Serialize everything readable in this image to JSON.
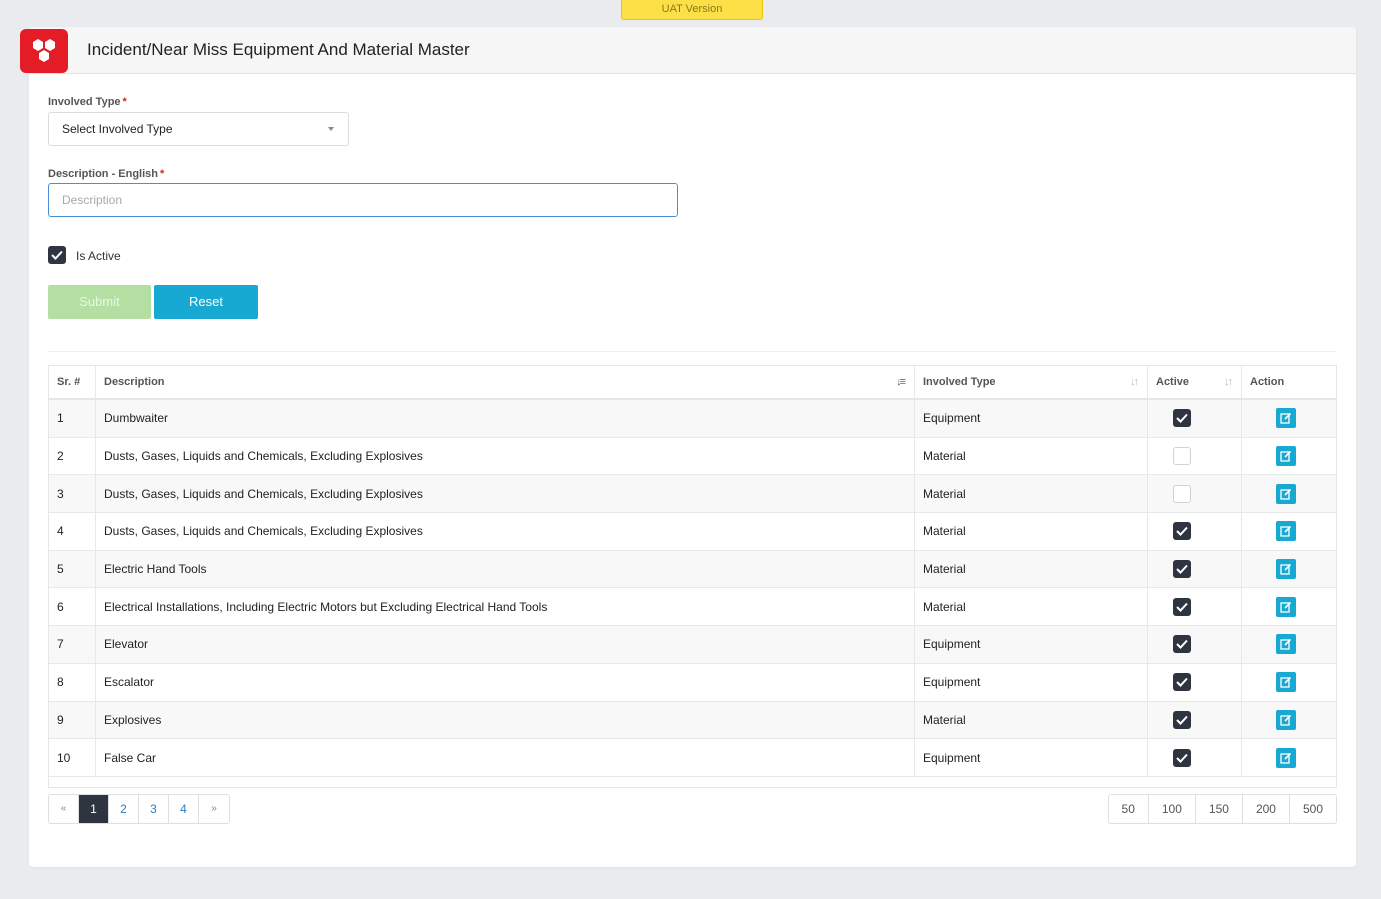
{
  "banner": "UAT Version",
  "header": {
    "title": "Incident/Near Miss Equipment And Material Master"
  },
  "form": {
    "involved_type_label": "Involved Type",
    "involved_type_value": "Select Involved Type",
    "description_label": "Description - English",
    "description_placeholder": "Description",
    "description_value": "",
    "required_mark": "*",
    "is_active_label": "Is Active",
    "is_active_checked": true,
    "submit_label": "Submit",
    "reset_label": "Reset"
  },
  "table": {
    "headers": {
      "sr": "Sr. #",
      "description": "Description",
      "involved_type": "Involved Type",
      "active": "Active",
      "action": "Action"
    },
    "rows": [
      {
        "sr": "1",
        "description": "Dumbwaiter",
        "type": "Equipment",
        "active": true
      },
      {
        "sr": "2",
        "description": "Dusts, Gases, Liquids and Chemicals, Excluding Explosives",
        "type": "Material",
        "active": false
      },
      {
        "sr": "3",
        "description": "Dusts, Gases, Liquids and Chemicals, Excluding Explosives",
        "type": "Material",
        "active": false
      },
      {
        "sr": "4",
        "description": "Dusts, Gases, Liquids and Chemicals, Excluding Explosives",
        "type": "Material",
        "active": true
      },
      {
        "sr": "5",
        "description": "Electric Hand Tools",
        "type": "Material",
        "active": true
      },
      {
        "sr": "6",
        "description": "Electrical Installations, Including Electric Motors but Excluding Electrical Hand Tools",
        "type": "Material",
        "active": true
      },
      {
        "sr": "7",
        "description": "Elevator",
        "type": "Equipment",
        "active": true
      },
      {
        "sr": "8",
        "description": "Escalator",
        "type": "Equipment",
        "active": true
      },
      {
        "sr": "9",
        "description": "Explosives",
        "type": "Material",
        "active": true
      },
      {
        "sr": "10",
        "description": "False Car",
        "type": "Equipment",
        "active": true
      }
    ]
  },
  "pagination": {
    "prev": "«",
    "next": "»",
    "pages": [
      "1",
      "2",
      "3",
      "4"
    ],
    "current": "1",
    "page_sizes": [
      "50",
      "100",
      "150",
      "200",
      "500"
    ]
  },
  "colors": {
    "accent": "#17a9d1",
    "brand": "#e31c25",
    "dark": "#2f3540",
    "submit_disabled": "#b3e0a2"
  },
  "icons": {
    "logo": "hexagon-logo-icon",
    "edit": "edit-icon",
    "check": "check-icon",
    "sort": "sort-icon",
    "caret": "caret-down-icon"
  }
}
